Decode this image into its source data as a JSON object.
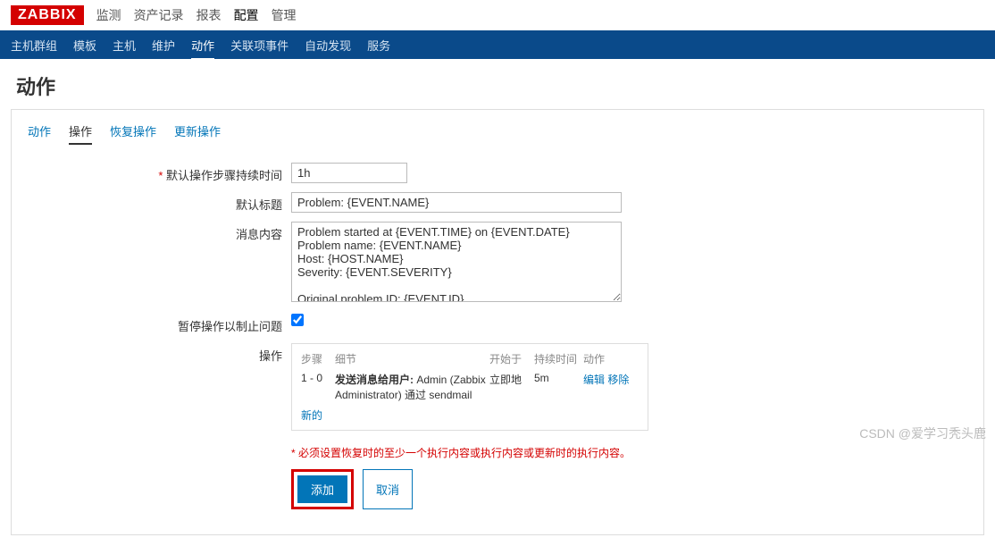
{
  "logo": "ZABBIX",
  "top_nav": [
    "监测",
    "资产记录",
    "报表",
    "配置",
    "管理"
  ],
  "top_nav_active": 3,
  "blue_nav": [
    "主机群组",
    "模板",
    "主机",
    "维护",
    "动作",
    "关联项事件",
    "自动发现",
    "服务"
  ],
  "blue_nav_active": 4,
  "page_title": "动作",
  "sub_tabs": [
    "动作",
    "操作",
    "恢复操作",
    "更新操作"
  ],
  "sub_tabs_active": 1,
  "labels": {
    "duration": "默认操作步骤持续时间",
    "subject": "默认标题",
    "message": "消息内容",
    "pause": "暂停操作以制止问题",
    "operations": "操作"
  },
  "fields": {
    "duration": "1h",
    "subject": "Problem: {EVENT.NAME}",
    "message": "Problem started at {EVENT.TIME} on {EVENT.DATE}\nProblem name: {EVENT.NAME}\nHost: {HOST.NAME}\nSeverity: {EVENT.SEVERITY}\n\nOriginal problem ID: {EVENT.ID}\n{TRIGGER.URL}",
    "pause_checked": true
  },
  "ops_header": {
    "steps": "步骤",
    "detail": "细节",
    "start": "开始于",
    "dur": "持续时间",
    "act": "动作"
  },
  "ops_row": {
    "steps": "1 - 0",
    "detail_prefix": "发送消息给用户:",
    "detail_rest": " Admin (Zabbix Administrator) 通过 sendmail",
    "start": "立即地",
    "dur": "5m",
    "edit": "编辑",
    "remove": "移除"
  },
  "new_label": "新的",
  "hint": "必须设置恢复时的至少一个执行内容或执行内容或更新时的执行内容。",
  "buttons": {
    "add": "添加",
    "cancel": "取消"
  },
  "watermark": "CSDN @爱学习秃头鹿"
}
